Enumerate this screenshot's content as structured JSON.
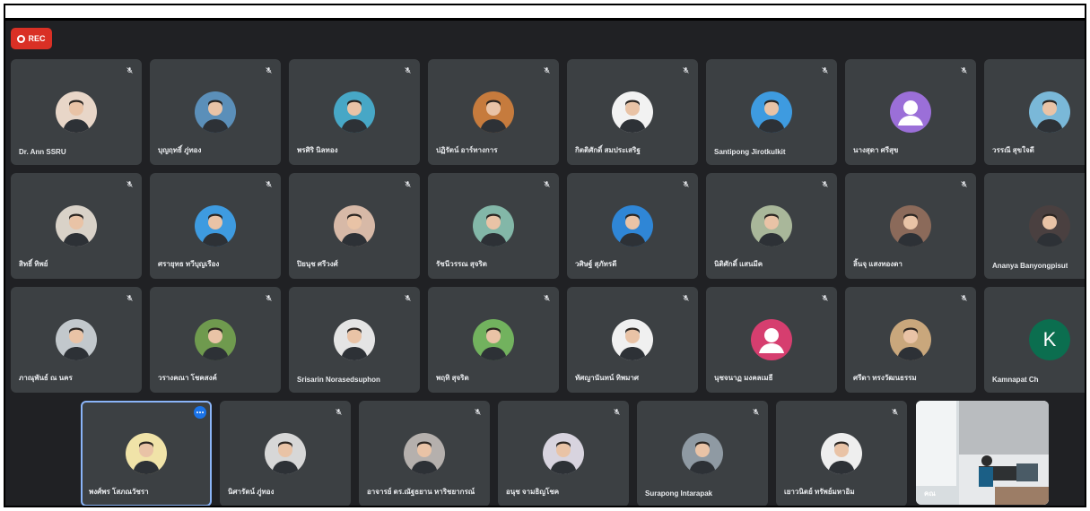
{
  "recording": {
    "label": "REC"
  },
  "participants": [
    {
      "name": "Dr. Ann SSRU",
      "avatar": "photo",
      "color": "#e8d6c8"
    },
    {
      "name": "บุญฤทธิ์ ภู่ทอง",
      "avatar": "photo",
      "color": "#5b8fb9"
    },
    {
      "name": "พรศิริ นิลทอง",
      "avatar": "photo",
      "color": "#47a7c6"
    },
    {
      "name": "ปฏิรัตน์ อาร์ทางการ",
      "avatar": "photo",
      "color": "#c67b3d"
    },
    {
      "name": "กิตติศักดิ์ สมประเสริฐ",
      "avatar": "photo",
      "color": "#f2f2f2"
    },
    {
      "name": "Santipong Jirotkulkit",
      "avatar": "photo",
      "color": "#3e9be0"
    },
    {
      "name": "นางสุดา ศรีสุข",
      "avatar": "default",
      "color": "#9b6fd8"
    },
    {
      "name": "วรรณี สุขใจดี",
      "avatar": "photo",
      "color": "#7ab8d8"
    },
    {
      "name": "สิทธิ์ ทิพย์",
      "avatar": "photo",
      "color": "#d9d2c8"
    },
    {
      "name": "ศรายุทธ ทวีบุญเรือง",
      "avatar": "photo",
      "color": "#3e9be0"
    },
    {
      "name": "ปิยนุช ศรีวงศ์",
      "avatar": "photo",
      "color": "#d7b9a7"
    },
    {
      "name": "รัชนีวรรณ สุจริต",
      "avatar": "photo",
      "color": "#83b7a8"
    },
    {
      "name": "วศิษฐ์ สุภัทรดี",
      "avatar": "photo",
      "color": "#2f86d6"
    },
    {
      "name": "นิติศักดิ์ แสนมีค",
      "avatar": "photo",
      "color": "#a9b79a"
    },
    {
      "name": "ลิ้นจุ แสงทองดา",
      "avatar": "photo",
      "color": "#8b6a5a"
    },
    {
      "name": "Ananya Banyongpisut",
      "avatar": "photo",
      "color": "#4a4040"
    },
    {
      "name": "ภาณุพันธ์ ณ นคร",
      "avatar": "photo",
      "color": "#c2c8cc"
    },
    {
      "name": "วรางคณา โชคสงค์",
      "avatar": "photo",
      "color": "#6f9a4e"
    },
    {
      "name": "Srisarin Norasedsuphon",
      "avatar": "photo",
      "color": "#e4e4e4"
    },
    {
      "name": "พฤทิ สุจริต",
      "avatar": "photo",
      "color": "#72b25e"
    },
    {
      "name": "ทัศญานันทน์ ทิพมาศ",
      "avatar": "photo",
      "color": "#f0f0f0"
    },
    {
      "name": "นุชจนาฏ มงคลเมธี",
      "avatar": "default",
      "color": "#d63e6f"
    },
    {
      "name": "ศรีดา ทรงวัฒนธรรม",
      "avatar": "photo",
      "color": "#c9a77c"
    },
    {
      "name": "Kamnapat Ch",
      "avatar": "letter",
      "letter": "K",
      "color": "#0b6e4f"
    },
    {
      "name": "พงศ์พร โสภณวัชรา",
      "avatar": "photo",
      "color": "#f0e3a8",
      "active": true
    },
    {
      "name": "นิศารัตน์ ภู่ทอง",
      "avatar": "photo",
      "color": "#d7d7d7"
    },
    {
      "name": "อาจารย์ ดร.ณัฐธยาน หาริชยากรณ์",
      "avatar": "photo",
      "color": "#b5b0ad"
    },
    {
      "name": "อนุช จามธิญโชค",
      "avatar": "photo",
      "color": "#d8d4df"
    },
    {
      "name": "Surapong Intarapak",
      "avatar": "photo",
      "color": "#8f9aa3"
    },
    {
      "name": "เยาวนิตย์ ทรัพย์มหาอิม",
      "avatar": "photo",
      "color": "#eeeeee"
    }
  ],
  "video_participant": {
    "name": "คณ"
  },
  "icons": {
    "mic_off": "mic-off-icon",
    "more": "more-options-icon",
    "record": "record-icon"
  }
}
